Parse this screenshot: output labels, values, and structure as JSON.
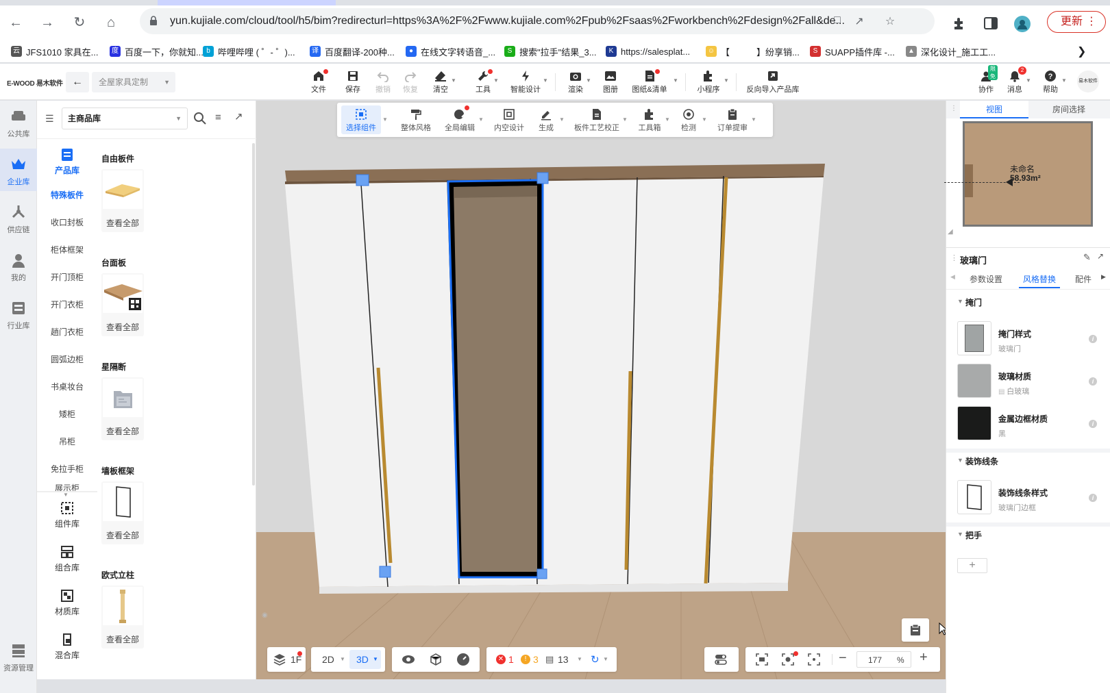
{
  "browser": {
    "url": "yun.kujiale.com/cloud/tool/h5/bim?redirecturl=https%3A%2F%2Fwww.kujiale.com%2Fpub%2Fsaas%2Fworkbench%2Fdesign%2Fall&de...",
    "update_label": "更新",
    "bookmarks": [
      {
        "label": "JFS1010 家具在...",
        "icon": "cloud-icon",
        "color": "#555555"
      },
      {
        "label": "百度一下，你就知...",
        "icon": "baidu-icon",
        "color": "#2932e1"
      },
      {
        "label": "哔哩哔哩 ( ゜- ゜)...",
        "icon": "bilibili-icon",
        "color": "#00a1d6"
      },
      {
        "label": "百度翻译-200种...",
        "icon": "translate-icon",
        "color": "#2468f2"
      },
      {
        "label": "在线文字转语音_...",
        "icon": "mic-icon",
        "color": "#2468f2"
      },
      {
        "label": "搜索\"拉手\"结果_3...",
        "icon": "search-site-icon",
        "color": "#1aad19"
      },
      {
        "label": "https://salesplat...",
        "icon": "k-icon",
        "color": "#1f3a93"
      },
      {
        "label": "【",
        "icon": "face-icon",
        "color": "#f4c542"
      },
      {
        "label": "】纷享销...",
        "icon": "",
        "color": ""
      },
      {
        "label": "SUAPP插件库 -...",
        "icon": "suapp-icon",
        "color": "#d32f2f"
      },
      {
        "label": "深化设计_施工工...",
        "icon": "design-icon",
        "color": "#888888"
      }
    ]
  },
  "app": {
    "logo": "E-WOOD 易木软件",
    "mode_select": "全屋家具定制",
    "toolbar": [
      {
        "label": "文件",
        "icon": "home-icon",
        "dot": true
      },
      {
        "label": "保存",
        "icon": "save-icon",
        "dot": false
      },
      {
        "label": "撤销",
        "icon": "undo-icon",
        "dot": false,
        "disabled": true
      },
      {
        "label": "恢复",
        "icon": "redo-icon",
        "dot": false,
        "disabled": true
      },
      {
        "label": "清空",
        "icon": "eraser-icon",
        "dot": false
      },
      {
        "label": "工具",
        "icon": "wrench-icon",
        "dot": true
      },
      {
        "label": "智能设计",
        "icon": "smart-design-icon",
        "dot": false
      },
      {
        "label": "渲染",
        "icon": "camera-icon",
        "dot": false
      },
      {
        "label": "图册",
        "icon": "album-icon",
        "dot": false
      },
      {
        "label": "图纸&清单",
        "icon": "drawing-list-icon",
        "dot": true
      },
      {
        "label": "小程序",
        "icon": "puzzle-icon",
        "dot": false
      },
      {
        "label": "反向导入产品库",
        "icon": "import-icon",
        "dot": false
      }
    ],
    "right_toolbar": [
      {
        "label": "协作",
        "icon": "collab-icon",
        "badge": "限免"
      },
      {
        "label": "消息",
        "icon": "bell-icon",
        "badge": "2"
      },
      {
        "label": "帮助",
        "icon": "help-icon",
        "badge": ""
      }
    ],
    "avatar_text": "易木软件"
  },
  "left_rail": [
    {
      "label": "公共库",
      "icon": "sofa-icon",
      "active": false
    },
    {
      "label": "企业库",
      "icon": "crown-icon",
      "active": true
    },
    {
      "label": "供应链",
      "icon": "supply-icon",
      "active": false
    },
    {
      "label": "我的",
      "icon": "user-icon",
      "active": false
    },
    {
      "label": "行业库",
      "icon": "cabinet-icon",
      "active": false
    },
    {
      "label": "资源管理",
      "icon": "resource-icon",
      "active": false
    }
  ],
  "library": {
    "source_select": "主商品库",
    "top_category": {
      "label": "产品库",
      "icon": "list-doc-icon"
    },
    "categories": [
      "特殊板件",
      "收口封板",
      "柜体框架",
      "开门顶柜",
      "开门衣柜",
      "趟门衣柜",
      "圆弧边柜",
      "书桌妆台",
      "矮柜",
      "吊柜",
      "免拉手柜",
      "展示柜"
    ],
    "bottom_categories": [
      {
        "label": "组件库",
        "icon": "component-icon"
      },
      {
        "label": "组合库",
        "icon": "combo-icon"
      },
      {
        "label": "材质库",
        "icon": "material-icon"
      },
      {
        "label": "混合库",
        "icon": "mix-icon"
      }
    ],
    "sections": [
      {
        "title": "自由板件",
        "view_all": "查看全部",
        "thumb": "board-thumb"
      },
      {
        "title": "台面板",
        "view_all": "查看全部",
        "thumb": "countertop-thumb"
      },
      {
        "title": "星隔断",
        "view_all": "查看全部",
        "thumb": "partition-thumb"
      },
      {
        "title": "墙板框架",
        "view_all": "查看全部",
        "thumb": "wall-frame-thumb"
      },
      {
        "title": "欧式立柱",
        "view_all": "查看全部",
        "thumb": "column-thumb"
      }
    ]
  },
  "viewport": {
    "toolbar": [
      {
        "label": "选择组件",
        "icon": "select-icon",
        "active": true
      },
      {
        "label": "整体风格",
        "icon": "paint-roller-icon",
        "active": false
      },
      {
        "label": "全局编辑",
        "icon": "global-edit-icon",
        "active": false,
        "dot": true
      },
      {
        "label": "内空设计",
        "icon": "inner-space-icon",
        "active": false
      },
      {
        "label": "生成",
        "icon": "generate-icon",
        "active": false
      },
      {
        "label": "板件工艺校正",
        "icon": "board-craft-icon",
        "active": false
      },
      {
        "label": "工具箱",
        "icon": "toolbox-icon",
        "active": false
      },
      {
        "label": "检测",
        "icon": "detect-icon",
        "active": false
      },
      {
        "label": "订单提审",
        "icon": "order-icon",
        "active": false
      }
    ],
    "bottom": {
      "floor": "1F",
      "view_2d": "2D",
      "view_3d": "3D",
      "errors": "1",
      "warnings": "3",
      "items": "13",
      "zoom": "177",
      "zoom_unit": "%"
    }
  },
  "right_panel": {
    "tabs": [
      "视图",
      "房间选择"
    ],
    "active_tab": 0,
    "room": {
      "name": "未命名",
      "area": "58.93m²"
    },
    "object_title": "玻璃门",
    "prop_tabs": [
      "参数设置",
      "风格替换",
      "配件"
    ],
    "active_prop_tab": 1,
    "groups": [
      {
        "title": "掩门",
        "options": [
          {
            "name": "掩门样式",
            "value": "玻璃门",
            "swatch": "#a0a4a4"
          },
          {
            "name": "玻璃材质",
            "value": "白玻璃",
            "swatch": "#a8aaaa"
          },
          {
            "name": "金属边框材质",
            "value": "黑",
            "swatch": "#1a1b1a"
          }
        ]
      },
      {
        "title": "装饰线条",
        "options": [
          {
            "name": "装饰线条样式",
            "value": "玻璃门边框",
            "swatch": "#ffffff"
          }
        ]
      },
      {
        "title": "把手",
        "options": []
      }
    ]
  }
}
